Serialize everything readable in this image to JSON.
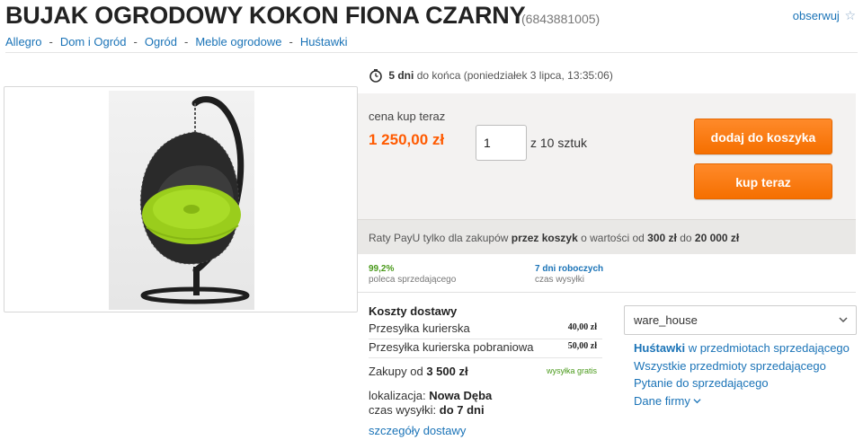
{
  "header": {
    "title": "BUJAK OGRODOWY KOKON FIONA CZARNY",
    "item_id": "(6843881005)",
    "watch_label": "obserwuj",
    "watch_star": "☆"
  },
  "breadcrumb": {
    "items": [
      "Allegro",
      "Dom i Ogród",
      "Ogród",
      "Meble ogrodowe",
      "Huśtawki"
    ],
    "separator": "-"
  },
  "countdown": {
    "days": "5 dni",
    "rest": "do końca (poniedziałek 3 lipca, 13:35:06)"
  },
  "purchase": {
    "price_label": "cena kup teraz",
    "price": "1 250,00 zł",
    "quantity": "1",
    "quantity_of": "z 10 sztuk",
    "add_to_cart": "dodaj do koszyka",
    "buy_now": "kup teraz",
    "accent_color": "#ff5a00"
  },
  "installments": {
    "part1": "Raty PayU tylko dla zakupów ",
    "bold1": "przez koszyk",
    "part2": " o wartości od ",
    "bold2": "300 zł",
    "part3": " do ",
    "bold3": "20 000 zł"
  },
  "stats": {
    "recommend_value": "99,2%",
    "recommend_label": "poleca sprzedającego",
    "shipping_time_value": "7 dni roboczych",
    "shipping_time_label": "czas wysyłki"
  },
  "shipping": {
    "heading": "Koszty dostawy",
    "rows": [
      {
        "label": "Przesyłka kurierska",
        "price": "40,00 zł"
      },
      {
        "label": "Przesyłka kurierska pobraniowa",
        "price": "50,00 zł"
      }
    ],
    "free_prefix": "Zakupy od ",
    "free_amount": "3 500 zł",
    "free_label": "wysyłka gratis",
    "location_label": "lokalizacja:",
    "location_value": "Nowa Dęba",
    "ship_time_label": "czas wysyłki:",
    "ship_time_value": "do 7 dni",
    "details_link": "szczegóły dostawy"
  },
  "seller": {
    "name": "ware_house",
    "link_category_bold": "Huśtawki",
    "link_category_rest": " w przedmiotach sprzedającego",
    "link_all": "Wszystkie przedmioty sprzedającego",
    "link_question": "Pytanie do sprzedającego",
    "link_company": "Dane firmy"
  },
  "product_image": {
    "alt": "egg-shaped hanging swing chair with lime green cushion on black stand"
  }
}
